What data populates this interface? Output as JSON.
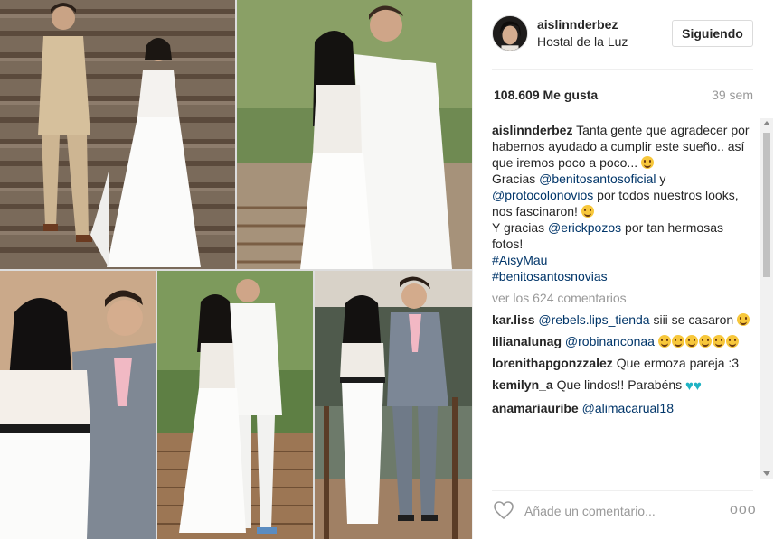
{
  "post": {
    "username": "aislinnderbez",
    "location": "Hostal de la Luz",
    "follow_label": "Siguiendo",
    "likes": "108.609 Me gusta",
    "time": "39 sem"
  },
  "caption": {
    "user": "aislinnderbez",
    "text1": "Tanta gente que agradecer por habernos ayudado a cumplir este sueño.. así que iremos poco a poco...",
    "text2": "Gracias",
    "mention1": "@benitosantosoficial",
    "text3": "y",
    "mention2": "@protocolonovios",
    "text4": "por todos nuestros looks, nos fascinaron!",
    "text5": "Y gracias",
    "mention3": "@erickpozos",
    "text6": "por tan hermosas fotos!",
    "hashtag1": "#AisyMau",
    "hashtag2": "#benitosantosnovias"
  },
  "view_all": "ver los 624 comentarios",
  "comments": [
    {
      "user": "kar.liss",
      "mention": "@rebels.lips_tienda",
      "text": "siii se casaron"
    },
    {
      "user": "lilianalunag",
      "mention": "@robinanconaa",
      "text": ""
    },
    {
      "user": "lorenithapgonzzalez",
      "mention": "",
      "text": "Que ermoza pareja :3"
    },
    {
      "user": "kemilyn_a",
      "mention": "",
      "text": "Que lindos!! Parabéns"
    },
    {
      "user": "anamariauribe",
      "mention": "@alimacarual18",
      "text": ""
    }
  ],
  "footer": {
    "comment_placeholder": "Añade un comentario...",
    "more_label": "ooo"
  },
  "colors": {
    "link": "#003569",
    "muted": "#999999",
    "text": "#262626",
    "heart_emoji": "#1fb3c4"
  },
  "icons": {
    "like": "heart-outline-icon",
    "more": "more-options-icon"
  }
}
